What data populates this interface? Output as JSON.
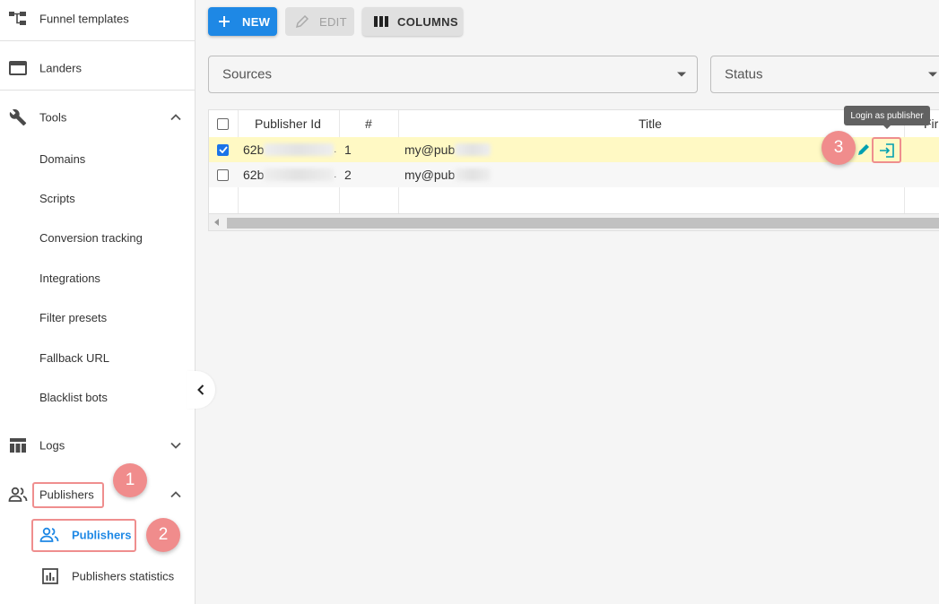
{
  "sidebar": {
    "funnel_templates": "Funnel templates",
    "landers": "Landers",
    "tools": {
      "label": "Tools",
      "items": [
        "Domains",
        "Scripts",
        "Conversion tracking",
        "Integrations",
        "Filter presets",
        "Fallback URL",
        "Blacklist bots"
      ]
    },
    "logs": "Logs",
    "publishers": {
      "label": "Publishers",
      "items": [
        "Publishers",
        "Publishers statistics"
      ]
    }
  },
  "toolbar": {
    "new_label": "NEW",
    "edit_label": "EDIT",
    "columns_label": "COLUMNS"
  },
  "filters": {
    "sources": "Sources",
    "status": "Status"
  },
  "table": {
    "headers": {
      "publisher_id": "Publisher Id",
      "number": "#",
      "title": "Title",
      "partial_next": "Fir"
    },
    "rows": [
      {
        "selected": true,
        "publisher_id": "62b",
        "number": "1",
        "title": "my@pub"
      },
      {
        "selected": false,
        "publisher_id": "62b",
        "number": "2",
        "title": "my@pub"
      }
    ]
  },
  "tooltip": "Login as publisher",
  "annotations": [
    "1",
    "2",
    "3"
  ],
  "colors": {
    "primary": "#1e88e5",
    "highlight_row": "#fff9c4",
    "annotation": "#f08c8c",
    "action_icon": "#00a0b0"
  }
}
